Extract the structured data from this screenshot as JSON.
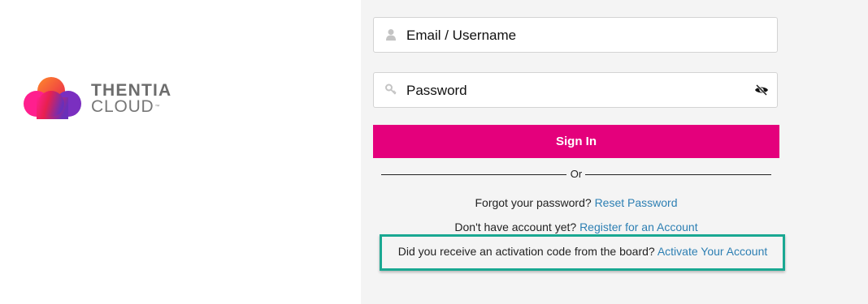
{
  "brand": {
    "line1": "THENTIA",
    "line2": "CLOUD",
    "tm": "™"
  },
  "login": {
    "email_placeholder": "Email / Username",
    "password_placeholder": "Password",
    "signin_label": "Sign In",
    "or_label": "Or"
  },
  "links": {
    "forgot_text": "Forgot your password?",
    "forgot_link": "Reset Password",
    "register_text": "Don't have account yet?",
    "register_link": "Register for an Account",
    "activation_text": "Did you receive an activation code from the board?",
    "activation_link": "Activate Your Account"
  },
  "icons": {
    "user": "user-icon",
    "key": "key-icon",
    "eye": "eye-slash-icon"
  },
  "colors": {
    "primary": "#e4007c",
    "link": "#2d7fb3",
    "highlight": "#1aa892",
    "panel_bg": "#f4f4f4"
  }
}
